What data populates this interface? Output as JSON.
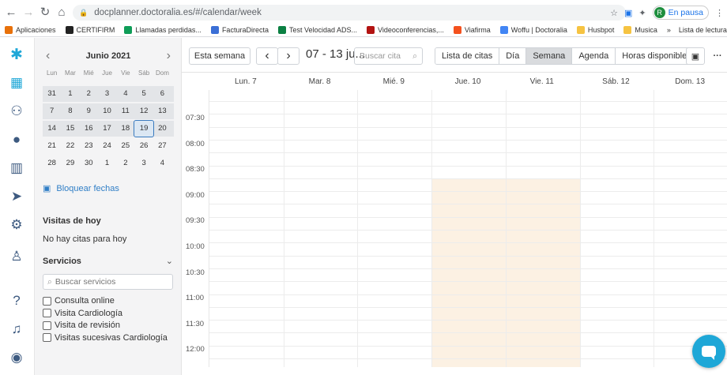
{
  "browser": {
    "url": "docplanner.doctoralia.es/#/calendar/week",
    "profile_initial": "R",
    "profile_status": "En pausa",
    "bookmarks": [
      {
        "label": "Aplicaciones",
        "color": "#e8710a"
      },
      {
        "label": "CERTIFIRM",
        "color": "#222222"
      },
      {
        "label": "Llamadas perdidas...",
        "color": "#0f9d58"
      },
      {
        "label": "FacturaDirecta",
        "color": "#3b6fd6"
      },
      {
        "label": "Test Velocidad ADS...",
        "color": "#0b8043"
      },
      {
        "label": "Videoconferencias,...",
        "color": "#b31412"
      },
      {
        "label": "Viafirma",
        "color": "#f4511e"
      },
      {
        "label": "Woffu | Doctoralia",
        "color": "#4285f4"
      },
      {
        "label": "Husbpot",
        "color": "#f6c342"
      },
      {
        "label": "Musica",
        "color": "#f6c342"
      }
    ],
    "more_bookmarks": "»",
    "reading_list": "Lista de lectura"
  },
  "mini_calendar": {
    "title": "Junio 2021",
    "weekdays": [
      "Lun",
      "Mar",
      "Mié",
      "Jue",
      "Vie",
      "Sáb",
      "Dom"
    ],
    "weeks": [
      [
        "31",
        "1",
        "2",
        "3",
        "4",
        "5",
        "6"
      ],
      [
        "7",
        "8",
        "9",
        "10",
        "11",
        "12",
        "13"
      ],
      [
        "14",
        "15",
        "16",
        "17",
        "18",
        "19",
        "20"
      ],
      [
        "21",
        "22",
        "23",
        "24",
        "25",
        "26",
        "27"
      ],
      [
        "28",
        "29",
        "30",
        "1",
        "2",
        "3",
        "4"
      ]
    ],
    "today": "19"
  },
  "sidebar": {
    "block_dates": "Bloquear fechas",
    "visits_title": "Visitas de hoy",
    "no_visits": "No hay citas para hoy",
    "services_title": "Servicios",
    "services_search_placeholder": "Buscar servicios",
    "services": [
      "Consulta online",
      "Visita Cardiología",
      "Visita de revisión",
      "Visitas sucesivas Cardiología"
    ]
  },
  "toolbar": {
    "this_week": "Esta semana",
    "prev": "‹",
    "next": "›",
    "date_range": "07 - 13 ju...",
    "search_placeholder": "Buscar cita",
    "views": [
      "Lista de citas",
      "Día",
      "Semana",
      "Agenda",
      "Horas disponibles"
    ],
    "active_view": "Semana",
    "more": "···"
  },
  "calendar": {
    "days": [
      "Lun. 7",
      "Mar. 8",
      "Mié. 9",
      "Jue. 10",
      "Vie. 11",
      "Sáb. 12",
      "Dom. 13"
    ],
    "hours": [
      "07:30",
      "08:00",
      "08:30",
      "09:00",
      "09:30",
      "10:00",
      "10:30",
      "11:00",
      "11:30",
      "12:00"
    ],
    "available_days": [
      "Jue. 10",
      "Vie. 11"
    ],
    "available_from": "09:00",
    "available_color": "#fcf1e3"
  }
}
